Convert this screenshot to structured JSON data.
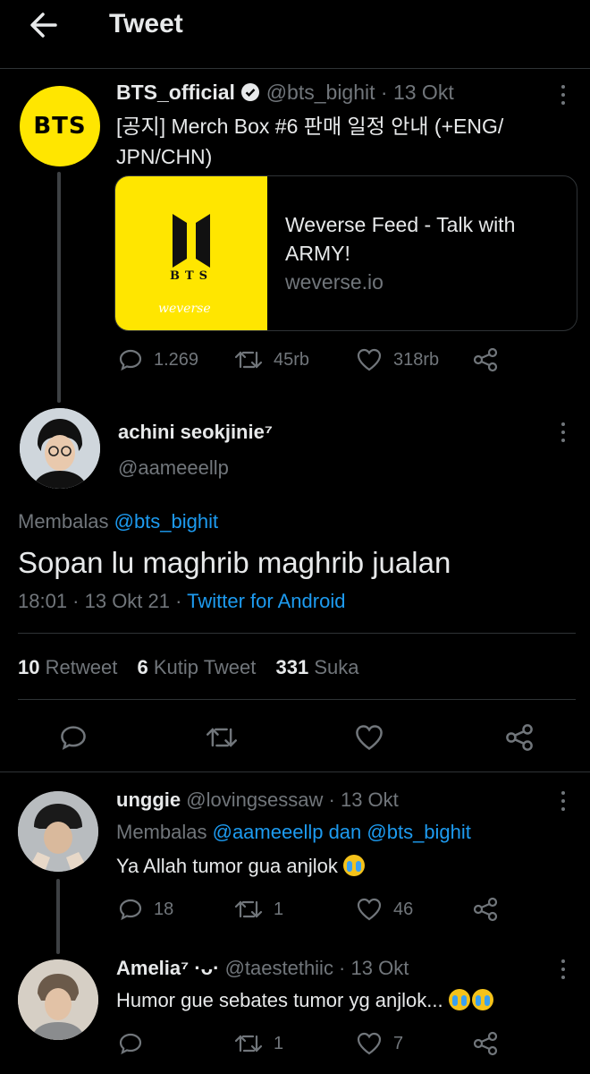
{
  "header": {
    "title": "Tweet"
  },
  "quoted_tweet": {
    "avatar_text": "BTS",
    "name": "BTS_official",
    "handle": "@bts_bighit",
    "date": "· 13 Okt",
    "text_line1": "[공지] Merch Box #6 판매 일정 안내 (+ENG/",
    "text_line2": "JPN/CHN)",
    "card": {
      "logo_text": "BTS",
      "brand_text": "weverse",
      "title_line1": "Weverse Feed - Talk with",
      "title_line2": "ARMY!",
      "domain": "weverse.io"
    },
    "stats": {
      "replies": "1.269",
      "retweets": "45rb",
      "likes": "318rb"
    }
  },
  "main_tweet": {
    "name": "achini seokjinie⁷",
    "handle": "@aameeellp",
    "reply_prefix": "Membalas",
    "reply_to": "@bts_bighit",
    "text": "Sopan lu maghrib maghrib jualan",
    "time": "18:01 · 13 Okt 21 ·",
    "source": "Twitter for Android",
    "retweets_count": "10",
    "retweets_label": "Retweet",
    "quotes_count": "6",
    "quotes_label": "Kutip Tweet",
    "likes_count": "331",
    "likes_label": "Suka"
  },
  "replies": [
    {
      "name": "unggie",
      "handle": "@lovingsessaw · 13 Okt",
      "reply_prefix": "Membalas",
      "reply_to": "@aameeellp dan @bts_bighit",
      "text": "Ya Allah tumor gua anjlok",
      "replies": "18",
      "retweets": "1",
      "likes": "46"
    },
    {
      "name": "Amelia⁷ ·ᴗ·",
      "handle": "@taestethiic · 13 Okt",
      "text": "Humor gue sebates tumor yg anjlok...",
      "replies": "",
      "retweets": "1",
      "likes": "7"
    }
  ],
  "colors": {
    "accent": "#1d9bf0",
    "background": "#000000",
    "muted": "#71767b",
    "bts_yellow": "#ffe600"
  }
}
